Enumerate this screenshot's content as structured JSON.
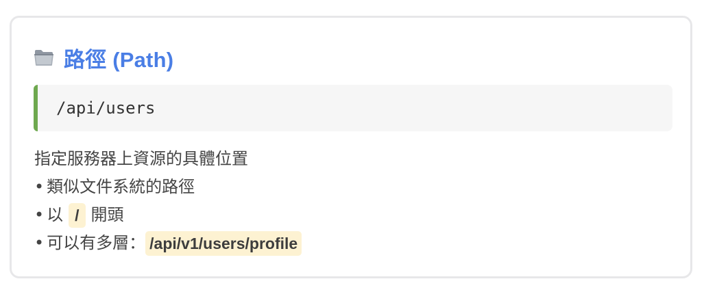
{
  "section": {
    "icon": "folder-icon",
    "title": "路徑 (Path)",
    "accent_color": "#4a7ee5"
  },
  "code_example": {
    "text": "/api/users",
    "border_color": "#6ea84f"
  },
  "description": {
    "intro": "指定服務器上資源的具體位置",
    "bullets": [
      {
        "bullet": "•",
        "text": "類似文件系統的路徑"
      },
      {
        "bullet": "•",
        "before": "以",
        "code": "/",
        "after": "開頭"
      },
      {
        "bullet": "•",
        "before": "可以有多層：",
        "code": "/api/v1/users/profile"
      }
    ],
    "inline_code_bg": "#fdf2d2"
  }
}
